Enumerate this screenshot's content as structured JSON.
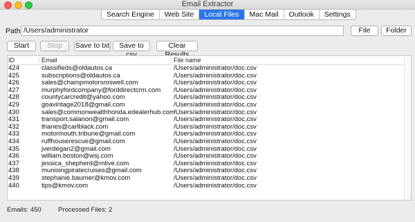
{
  "window": {
    "title": "Email Extractor"
  },
  "tabs": [
    "Search Engine",
    "Web Site",
    "Local Files",
    "Mac Mail",
    "Outlook",
    "Settings"
  ],
  "active_tab": "Local Files",
  "path": {
    "label": "Path:",
    "value": "/Users/administrator"
  },
  "buttons": {
    "file": "File",
    "folder": "Folder",
    "start": "Start",
    "stop": "Stop",
    "save_txt": "Save to txt",
    "save_csv": "Save to csv",
    "clear": "Clear Results"
  },
  "table": {
    "headers": {
      "id": "ID",
      "email": "Email",
      "file": "File name"
    },
    "rows": [
      {
        "id": "424",
        "email": "classifieds@oldautos.ca",
        "file": "/Users/administrator/doc.csv"
      },
      {
        "id": "425",
        "email": "subscriptions@oldautos.ca",
        "file": "/Users/administrator/doc.csv"
      },
      {
        "id": "426",
        "email": "sales@champmotorsroswell.com",
        "file": "/Users/administrator/doc.csv"
      },
      {
        "id": "427",
        "email": "murphyfordcompany@forddirectcrm.com",
        "file": "/Users/administrator/doc.csv"
      },
      {
        "id": "428",
        "email": "countycarcredit@yahoo.com",
        "file": "/Users/administrator/doc.csv"
      },
      {
        "id": "429",
        "email": "goavintage2018@gmail.com",
        "file": "/Users/administrator/doc.csv"
      },
      {
        "id": "430",
        "email": "sales@commonwealthhonda.edealerhub.com",
        "file": "/Users/administrator/doc.csv"
      },
      {
        "id": "431",
        "email": "transport.salanon@gmail.com",
        "file": "/Users/administrator/doc.csv"
      },
      {
        "id": "432",
        "email": "thanes@carlblack.com",
        "file": "/Users/administrator/doc.csv"
      },
      {
        "id": "433",
        "email": "motormouth.tribune@gmail.com",
        "file": "/Users/administrator/doc.csv"
      },
      {
        "id": "434",
        "email": "ruffhouserescue@gmail.com",
        "file": "/Users/administrator/doc.csv"
      },
      {
        "id": "435",
        "email": "jverdegan2@gmail.com",
        "file": "/Users/administrator/doc.csv"
      },
      {
        "id": "436",
        "email": "william.boston@wsj.com",
        "file": "/Users/administrator/doc.csv"
      },
      {
        "id": "437",
        "email": "jessica_shepherd@mlive.com",
        "file": "/Users/administrator/doc.csv"
      },
      {
        "id": "438",
        "email": "munisingpiratecruises@gmail.com",
        "file": "/Users/administrator/doc.csv"
      },
      {
        "id": "439",
        "email": "stephanie.baumer@kmov.com",
        "file": "/Users/administrator/doc.csv"
      },
      {
        "id": "440",
        "email": "tips@kmov.com",
        "file": "/Users/administrator/doc.csv"
      }
    ]
  },
  "status": {
    "emails": "Emails: 450",
    "processed": "Processed Files: 2"
  }
}
